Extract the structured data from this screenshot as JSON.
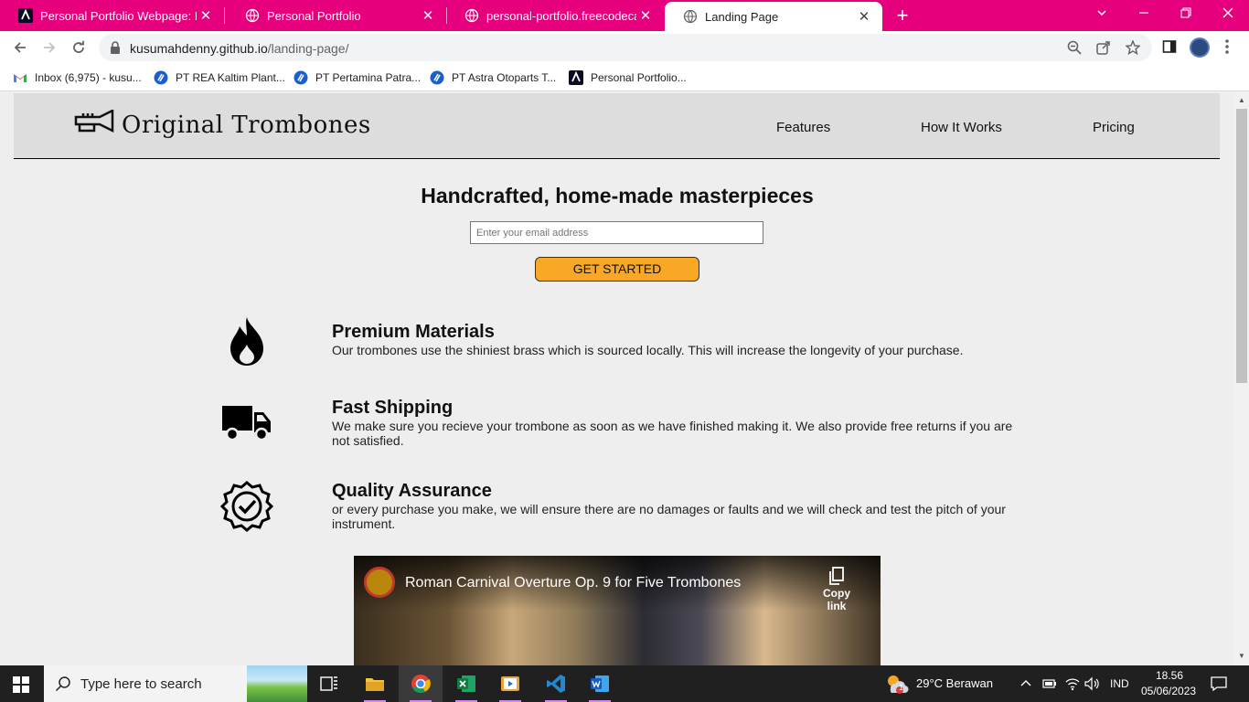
{
  "browser": {
    "tabs": [
      {
        "title": "Personal Portfolio Webpage: Buil",
        "favicon": "freecodecamp-icon",
        "active": false
      },
      {
        "title": "Personal Portfolio",
        "favicon": "globe-icon",
        "active": false
      },
      {
        "title": "personal-portfolio.freecodecamp",
        "favicon": "globe-icon",
        "active": false
      },
      {
        "title": "Landing Page",
        "favicon": "globe-icon",
        "active": true
      }
    ],
    "new_tab_label": "+",
    "url_host": "kusumahdenny.github.io",
    "url_path": "/landing-page/",
    "bookmarks": [
      {
        "label": "Inbox (6,975) - kusu...",
        "icon": "gmail-icon"
      },
      {
        "label": "PT REA Kaltim Plant...",
        "icon": "blue-badge-icon"
      },
      {
        "label": "PT Pertamina Patra...",
        "icon": "blue-badge-icon"
      },
      {
        "label": "PT Astra Otoparts T...",
        "icon": "blue-badge-icon"
      },
      {
        "label": "Personal Portfolio...",
        "icon": "freecodecamp-icon"
      }
    ],
    "accent": "#e6007e"
  },
  "page": {
    "logo_text": "Original Trombones",
    "nav": [
      "Features",
      "How It Works",
      "Pricing"
    ],
    "hero_title": "Handcrafted, home-made masterpieces",
    "email_placeholder": "Enter your email address",
    "cta_label": "GET STARTED",
    "cta_color": "#f9a825",
    "features": [
      {
        "icon": "fire-icon",
        "title": "Premium Materials",
        "desc": "Our trombones use the shiniest brass which is sourced locally. This will increase the longevity of your purchase."
      },
      {
        "icon": "truck-icon",
        "title": "Fast Shipping",
        "desc": "We make sure you recieve your trombone as soon as we have finished making it. We also provide free returns if you are not satisfied."
      },
      {
        "icon": "badge-check-icon",
        "title": "Quality Assurance",
        "desc": "or every purchase you make, we will ensure there are no damages or faults and we will check and test the pitch of your instrument."
      }
    ],
    "video": {
      "title": "Roman Carnival Overture Op. 9 for Five Trombones",
      "copy_label": "Copy link"
    }
  },
  "taskbar": {
    "search_placeholder": "Type here to search",
    "weather": "29°C  Berawan",
    "language": "IND",
    "time": "18.56",
    "date": "05/06/2023",
    "weather_badge": "1"
  }
}
